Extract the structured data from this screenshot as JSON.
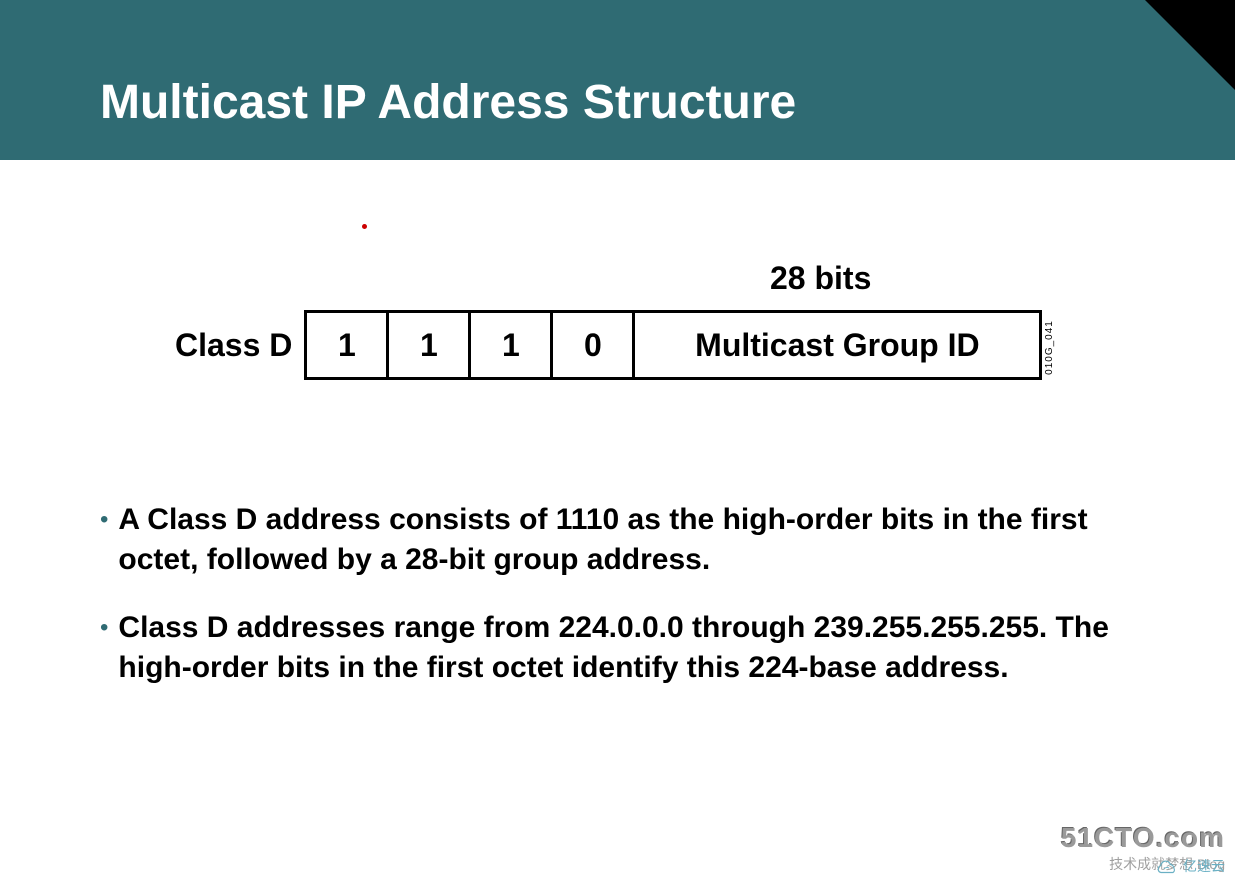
{
  "header": {
    "title": "Multicast IP Address Structure"
  },
  "diagram": {
    "bits_label": "28 bits",
    "class_label": "Class D",
    "bits": [
      "1",
      "1",
      "1",
      "0"
    ],
    "group_field": "Multicast Group ID",
    "side_code": "010G_041"
  },
  "bullets": [
    "A Class D address consists of 1110 as the high-order bits in the first octet, followed by a 28-bit group address.",
    "Class D addresses range from 224.0.0.0 through 239.255.255.255. The high-order bits in the first octet identify this 224-base address."
  ],
  "watermark": {
    "main": "51CTO.com",
    "sub": "技术成就梦想 Blog",
    "cloud": "亿速云"
  }
}
